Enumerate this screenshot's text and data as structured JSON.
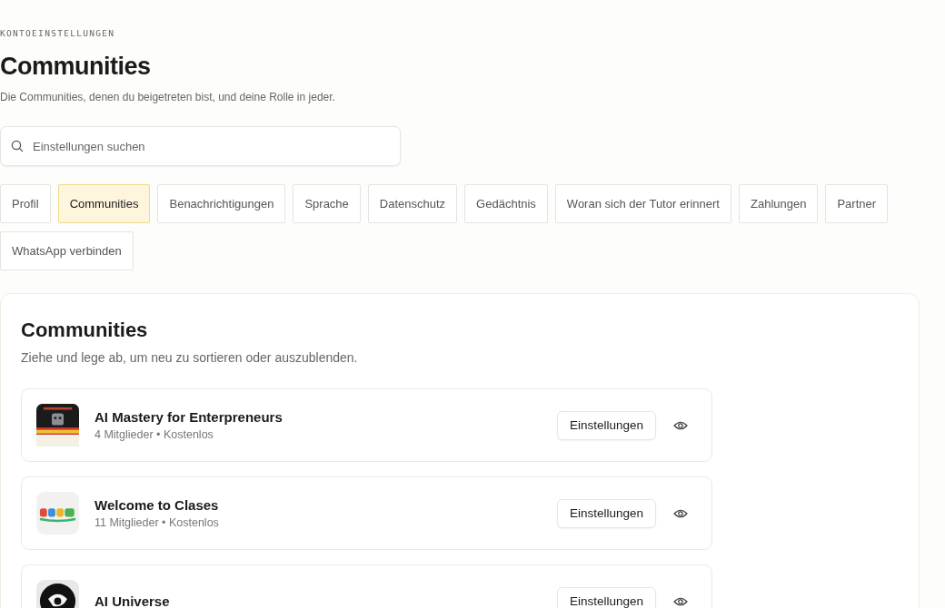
{
  "kicker": "KONTOEINSTELLUNGEN",
  "title": "Communities",
  "subtitle": "Die Communities, denen du beigetreten bist, und deine Rolle in jeder.",
  "search": {
    "placeholder": "Einstellungen suchen"
  },
  "tabs": [
    {
      "label": "Profil",
      "selected": false
    },
    {
      "label": "Communities",
      "selected": true
    },
    {
      "label": "Benachrichtigungen",
      "selected": false
    },
    {
      "label": "Sprache",
      "selected": false
    },
    {
      "label": "Datenschutz",
      "selected": false
    },
    {
      "label": "Gedächtnis",
      "selected": false
    },
    {
      "label": "Woran sich der Tutor erinnert",
      "selected": false
    },
    {
      "label": "Zahlungen",
      "selected": false
    },
    {
      "label": "Partner",
      "selected": false
    },
    {
      "label": "WhatsApp verbinden",
      "selected": false
    }
  ],
  "panel": {
    "title": "Communities",
    "hint": "Ziehe und lege ab, um neu zu sortieren oder auszublenden.",
    "communities": [
      {
        "name": "AI Mastery for Enterpreneurs",
        "meta": "4 Mitglieder • Kostenlos",
        "button": "Einstellungen"
      },
      {
        "name": "Welcome to Clases",
        "meta": "11 Mitglieder • Kostenlos",
        "button": "Einstellungen"
      },
      {
        "name": "AI Universe",
        "button": "Einstellungen"
      }
    ]
  }
}
